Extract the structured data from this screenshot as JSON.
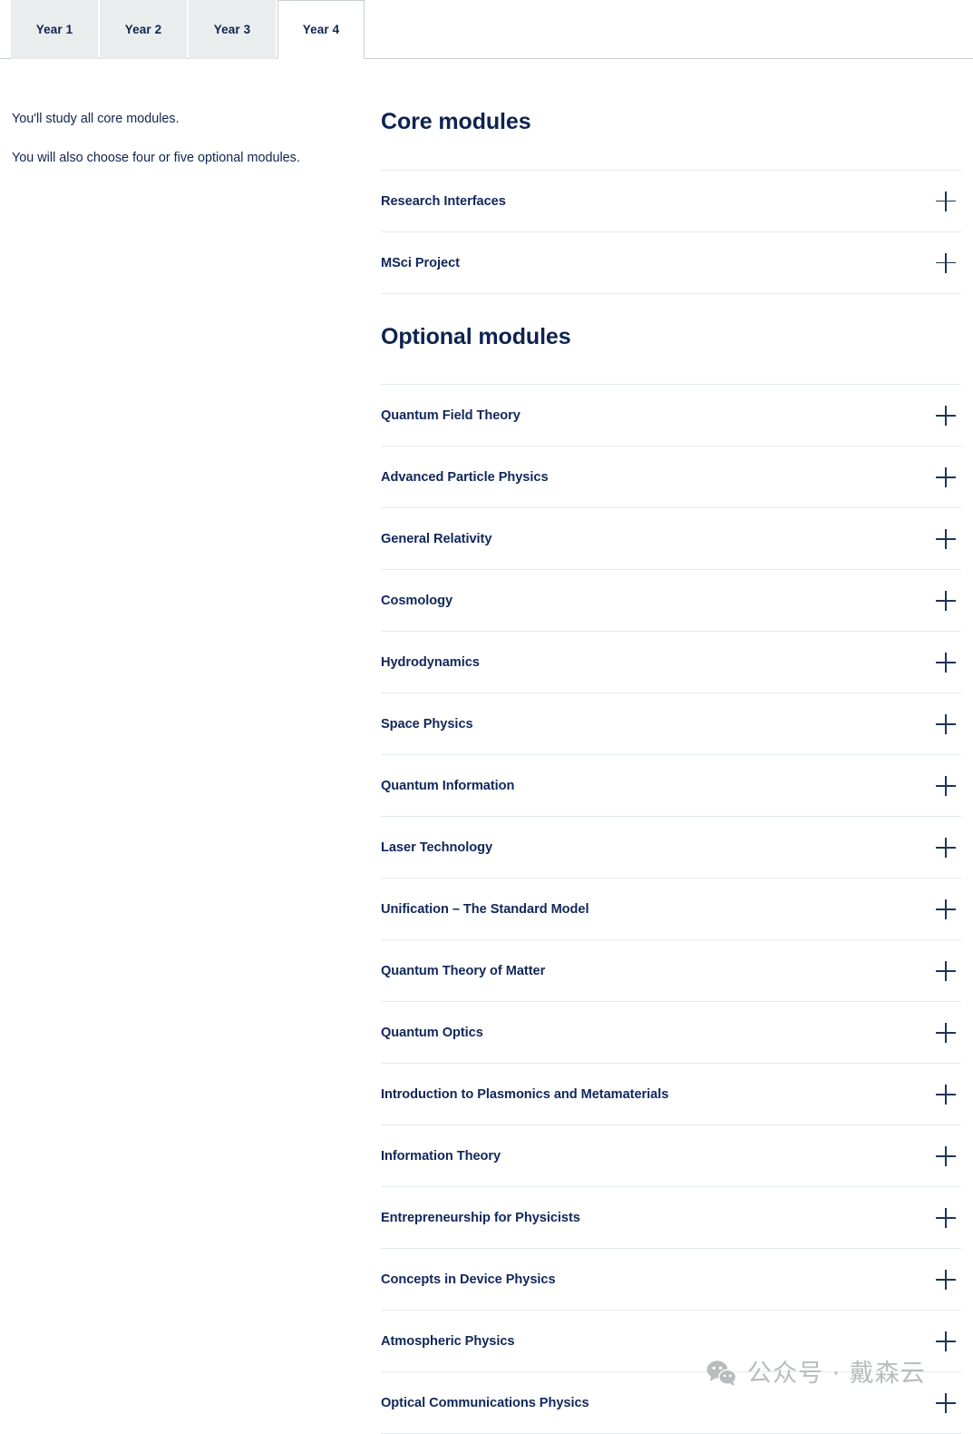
{
  "tabs": {
    "items": [
      {
        "label": "Year 1",
        "active": false
      },
      {
        "label": "Year 2",
        "active": false
      },
      {
        "label": "Year 3",
        "active": false
      },
      {
        "label": "Year 4",
        "active": true
      }
    ]
  },
  "intro": {
    "paragraph_1": "You'll study all core modules.",
    "paragraph_2": "You will also choose four or five optional modules."
  },
  "core_section": {
    "heading": "Core modules",
    "modules": [
      "Research Interfaces",
      "MSci Project"
    ]
  },
  "optional_section": {
    "heading": "Optional modules",
    "modules": [
      "Quantum Field Theory",
      "Advanced Particle Physics",
      "General Relativity",
      "Cosmology",
      "Hydrodynamics",
      "Space Physics",
      "Quantum Information",
      "Laser Technology",
      "Unification – The Standard Model",
      "Quantum Theory of Matter",
      "Quantum Optics",
      "Introduction to Plasmonics and Metamaterials",
      "Information Theory",
      "Entrepreneurship for Physicists",
      "Concepts in Device Physics",
      "Atmospheric Physics",
      "Optical Communications Physics"
    ]
  },
  "icons": {
    "expand": "plus-icon"
  },
  "watermark": {
    "icon": "wechat-icon",
    "text": "公众号 · 戴森云"
  },
  "colors": {
    "heading": "#0d2350",
    "label": "#11275a",
    "tab_inactive_bg": "#e9edee",
    "tab_active_bg": "#ffffff",
    "divider": "#e4eaea",
    "tab_border": "#c9ced1",
    "watermark": "#b9bcbe"
  }
}
